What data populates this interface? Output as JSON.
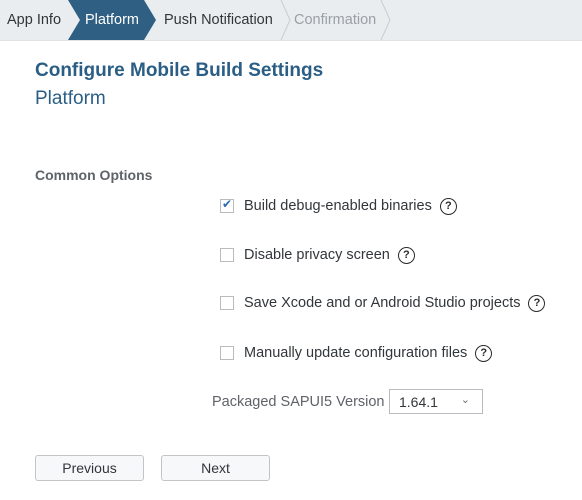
{
  "wizard": {
    "steps": [
      {
        "label": "App Info",
        "state": "done"
      },
      {
        "label": "Platform",
        "state": "active"
      },
      {
        "label": "Push Notification",
        "state": "upcoming"
      },
      {
        "label": "Confirmation",
        "state": "disabled"
      }
    ],
    "active_color": "#2f5f82"
  },
  "header": {
    "title": "Configure Mobile Build Settings",
    "subtitle": "Platform"
  },
  "section": {
    "title": "Common Options"
  },
  "options": [
    {
      "label": "Build debug-enabled binaries",
      "checked": true,
      "help_icon": "question-circle-icon"
    },
    {
      "label": "Disable privacy screen",
      "checked": false,
      "help_icon": "question-circle-icon"
    },
    {
      "label": "Save Xcode and or Android Studio projects",
      "checked": false,
      "help_icon": "question-circle-icon"
    },
    {
      "label": "Manually update configuration files",
      "checked": false,
      "help_icon": "question-circle-icon"
    }
  ],
  "version": {
    "label": "Packaged SAPUI5 Version",
    "selected": "1.64.1",
    "chevron": "⌄"
  },
  "icons": {
    "check": "✔",
    "help": "?"
  },
  "footer": {
    "previous_label": "Previous",
    "next_label": "Next"
  }
}
